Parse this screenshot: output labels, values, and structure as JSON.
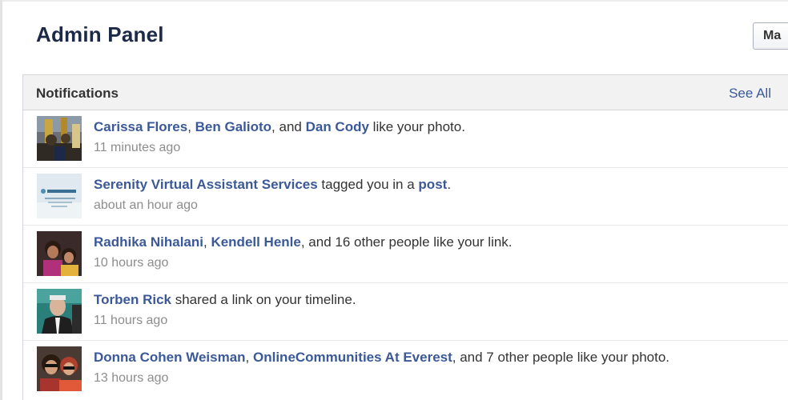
{
  "header": {
    "title": "Admin Panel",
    "menu_button_label": "Ma"
  },
  "panel": {
    "title": "Notifications",
    "see_all": "See All"
  },
  "notifications": [
    {
      "avatar": "group-photo",
      "parts": [
        {
          "t": "Carissa Flores",
          "link": true
        },
        {
          "t": ", ",
          "link": false
        },
        {
          "t": "Ben Galioto",
          "link": true
        },
        {
          "t": ", and ",
          "link": false
        },
        {
          "t": "Dan Cody",
          "link": true
        },
        {
          "t": " like your photo.",
          "link": false
        }
      ],
      "time": "11 minutes ago"
    },
    {
      "avatar": "serenity-logo",
      "parts": [
        {
          "t": "Serenity Virtual Assistant Services",
          "link": true
        },
        {
          "t": " tagged you in a ",
          "link": false
        },
        {
          "t": "post",
          "link": true
        },
        {
          "t": ".",
          "link": false
        }
      ],
      "time": "about an hour ago"
    },
    {
      "avatar": "two-people-photo",
      "parts": [
        {
          "t": "Radhika Nihalani",
          "link": true
        },
        {
          "t": ", ",
          "link": false
        },
        {
          "t": "Kendell Henle",
          "link": true
        },
        {
          "t": ", and 16 other people like your link.",
          "link": false
        }
      ],
      "time": "10 hours ago"
    },
    {
      "avatar": "man-portrait",
      "parts": [
        {
          "t": "Torben Rick",
          "link": true
        },
        {
          "t": " shared a link on your timeline.",
          "link": false
        }
      ],
      "time": "11 hours ago"
    },
    {
      "avatar": "two-women-photo",
      "parts": [
        {
          "t": "Donna Cohen Weisman",
          "link": true
        },
        {
          "t": ", ",
          "link": false
        },
        {
          "t": "OnlineCommunities At Everest",
          "link": true
        },
        {
          "t": ", and 7 other people like your photo.",
          "link": false
        }
      ],
      "time": "13 hours ago"
    }
  ],
  "colors": {
    "link": "#3b5998",
    "title": "#1c2a47",
    "time": "#8d8d8d",
    "header_bg": "#f2f2f2"
  }
}
